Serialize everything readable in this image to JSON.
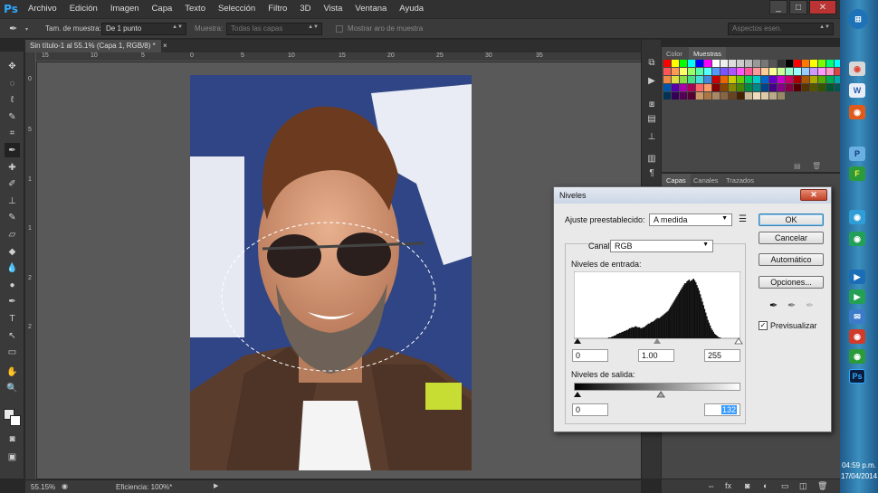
{
  "menubar": {
    "logo": "Ps",
    "items": [
      "Archivo",
      "Edición",
      "Imagen",
      "Capa",
      "Texto",
      "Selección",
      "Filtro",
      "3D",
      "Vista",
      "Ventana",
      "Ayuda"
    ],
    "window_buttons": [
      "_",
      "□",
      "✕"
    ]
  },
  "options": {
    "sample_size_label": "Tam. de muestra:",
    "sample_size_value": "De 1 punto",
    "sample_label": "Muestra:",
    "sample_value": "Todas las capas",
    "show_ring_label": "Mostrar aro de muestra",
    "workspace_value": "Aspectos esen."
  },
  "document": {
    "tab_title": "Sin título-1 al 55.1% (Capa 1, RGB/8) *",
    "tab_close": "×",
    "ruler_top": [
      "15",
      "10",
      "5",
      "0",
      "5",
      "10",
      "15",
      "20",
      "25",
      "30",
      "35"
    ],
    "ruler_left": [
      "0",
      "5",
      "1",
      "1",
      "2",
      "2"
    ]
  },
  "status": {
    "zoom": "55.15%",
    "efficiency": "Eficiencia: 100%*"
  },
  "swatch_panel": {
    "tabs": [
      "Color",
      "Muestras"
    ],
    "swatches": [
      "#ff0000",
      "#ffff00",
      "#00ff00",
      "#00ffff",
      "#0000ff",
      "#ff00ff",
      "#ffffff",
      "#eeeeee",
      "#dddddd",
      "#cccccc",
      "#bbbbbb",
      "#999999",
      "#777777",
      "#555555",
      "#333333",
      "#000000",
      "#ff0000",
      "#ff7700",
      "#ffff00",
      "#77ff00",
      "#00ff77",
      "#00ffff",
      "#ff5555",
      "#ff9955",
      "#ffff66",
      "#99ff66",
      "#55ffaa",
      "#55ffff",
      "#5599ff",
      "#7755ff",
      "#aa55ff",
      "#ff55ff",
      "#ff5599",
      "#ff9999",
      "#ffcc99",
      "#ffff99",
      "#ccff99",
      "#99ffcc",
      "#99ffff",
      "#99ccff",
      "#cc99ff",
      "#ff99ff",
      "#ff99cc",
      "#dd4444",
      "#ee8844",
      "#dddd44",
      "#88dd44",
      "#44dd88",
      "#44dddd",
      "#4488dd",
      "#cc0000",
      "#ee6600",
      "#cccc00",
      "#66cc00",
      "#00cc66",
      "#00cccc",
      "#0066cc",
      "#6600cc",
      "#cc00cc",
      "#cc0066",
      "#aa0000",
      "#aa5500",
      "#aaaa00",
      "#55aa00",
      "#00aa55",
      "#00aaaa",
      "#0055aa",
      "#5500aa",
      "#aa00aa",
      "#aa0055",
      "#ff6666",
      "#ff9966",
      "#880000",
      "#884400",
      "#888800",
      "#448800",
      "#008844",
      "#008888",
      "#004488",
      "#440088",
      "#880088",
      "#880044",
      "#550000",
      "#553300",
      "#555500",
      "#335500",
      "#005533",
      "#005555",
      "#003355",
      "#330055",
      "#550055",
      "#550033",
      "#cc9966",
      "#aa7744",
      "#aa8866",
      "#886644",
      "#664422",
      "#442200",
      "#ccbb99",
      "#eeddbb",
      "#ddccaa",
      "#bbaa88",
      "#998866"
    ],
    "icons": [
      "▤",
      "🗑"
    ]
  },
  "layers_panel": {
    "tabs": [
      "Capas",
      "Canales",
      "Trazados"
    ],
    "bottom_icons": [
      "⇔",
      "fx",
      "◙",
      "◐",
      "▭",
      "◫",
      "🗑"
    ]
  },
  "levels_dialog": {
    "title": "Niveles",
    "close": "✕",
    "preset_label": "Ajuste preestablecido:",
    "preset_value": "A medida",
    "channel_label": "Canal:",
    "channel_value": "RGB",
    "input_levels_label": "Niveles de entrada:",
    "input_black": "0",
    "input_gamma": "1.00",
    "input_white": "255",
    "output_levels_label": "Niveles de salida:",
    "output_black": "0",
    "output_white": "132",
    "output_white_level": 132,
    "buttons": {
      "ok": "OK",
      "cancel": "Cancelar",
      "auto": "Automático",
      "options": "Opciones..."
    },
    "preview_label": "Previsualizar",
    "preview_checked": true,
    "histogram": [
      0,
      0,
      0,
      0,
      0,
      0,
      0,
      0,
      0,
      0,
      0,
      0,
      0,
      0,
      0,
      0,
      0,
      0,
      0,
      0,
      0,
      0,
      0,
      0,
      0,
      0,
      0,
      0,
      0,
      0,
      0,
      1,
      1,
      1,
      2,
      2,
      3,
      3,
      4,
      5,
      5,
      6,
      6,
      7,
      7,
      8,
      8,
      9,
      9,
      10,
      11,
      11,
      12,
      12,
      12,
      13,
      13,
      12,
      12,
      12,
      11,
      11,
      12,
      12,
      13,
      14,
      15,
      16,
      16,
      17,
      18,
      18,
      19,
      20,
      21,
      22,
      22,
      22,
      23,
      24,
      25,
      26,
      27,
      28,
      29,
      30,
      32,
      34,
      36,
      38,
      40,
      42,
      44,
      46,
      48,
      50,
      52,
      54,
      56,
      58,
      60,
      60,
      62,
      63,
      64,
      62,
      63,
      64,
      65,
      63,
      61,
      58,
      55,
      52,
      48,
      44,
      40,
      36,
      32,
      28,
      24,
      20,
      17,
      14,
      11,
      9,
      7,
      5,
      4,
      3,
      2,
      1,
      1,
      0,
      0,
      0,
      0,
      0,
      0,
      0,
      0,
      0,
      0,
      0,
      0,
      0,
      0,
      0,
      0,
      0,
      0
    ]
  },
  "taskbar": {
    "time": "04:59 p.m.",
    "date": "17/04/2014",
    "icons": [
      "⊞",
      "◉",
      "W",
      "◉",
      "P",
      "F",
      "◉",
      "◉",
      "▶",
      "▶",
      "✉",
      "◉",
      "◉",
      "Ps"
    ]
  }
}
